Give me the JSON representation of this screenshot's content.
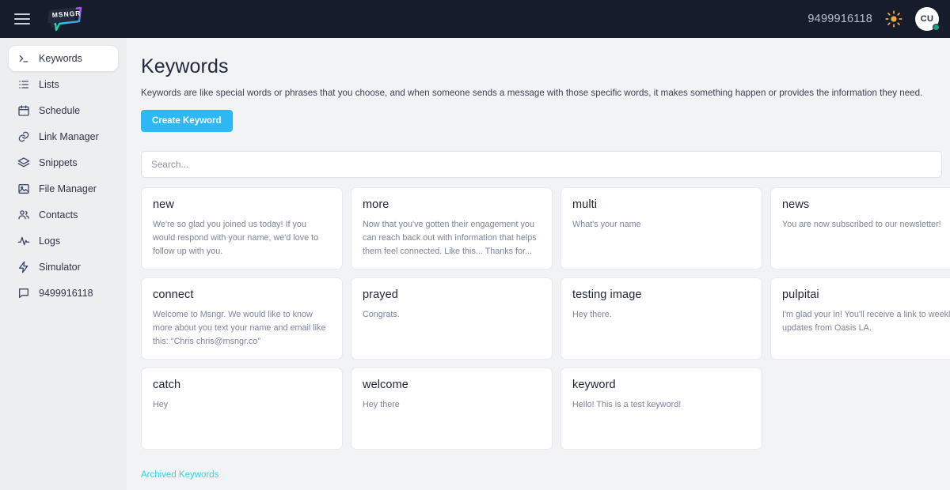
{
  "topbar": {
    "menu_icon": "hamburger-icon",
    "logo_text": "MSNGR",
    "phone": "9499916118",
    "theme_icon": "sun-icon",
    "avatar_initials": "CU",
    "status": "online"
  },
  "sidebar": {
    "items": [
      {
        "label": "Keywords",
        "icon": "terminal-icon",
        "active": true
      },
      {
        "label": "Lists",
        "icon": "list-icon",
        "active": false
      },
      {
        "label": "Schedule",
        "icon": "calendar-icon",
        "active": false
      },
      {
        "label": "Link Manager",
        "icon": "link-icon",
        "active": false
      },
      {
        "label": "Snippets",
        "icon": "layers-icon",
        "active": false
      },
      {
        "label": "File Manager",
        "icon": "image-icon",
        "active": false
      },
      {
        "label": "Contacts",
        "icon": "users-icon",
        "active": false
      },
      {
        "label": "Logs",
        "icon": "activity-icon",
        "active": false
      },
      {
        "label": "Simulator",
        "icon": "bolt-icon",
        "active": false
      },
      {
        "label": "9499916118",
        "icon": "chat-icon",
        "active": false
      }
    ]
  },
  "main": {
    "title": "Keywords",
    "description": "Keywords are like special words or phrases that you choose, and when someone sends a message with those specific words, it makes something happen or provides the information they need.",
    "create_button": "Create Keyword",
    "search_placeholder": "Search...",
    "search_value": "",
    "archived_link": "Archived Keywords",
    "keywords": [
      {
        "name": "new",
        "message": "We're so glad you joined us today! If you would respond with your name, we'd love to follow up with you."
      },
      {
        "name": "more",
        "message": "Now that you've gotten their engagement you can reach back out with information that helps them feel connected. Like this... Thanks for..."
      },
      {
        "name": "multi",
        "message": "What's your name"
      },
      {
        "name": "news",
        "message": "You are now subscribed to our newsletter!"
      },
      {
        "name": "connect",
        "message": "Welcome to Msngr. We would like to know more about you text your name and email like this: \"Chris chris@msngr.co\""
      },
      {
        "name": "prayed",
        "message": "Congrats."
      },
      {
        "name": "testing image",
        "message": "Hey there."
      },
      {
        "name": "pulpitai",
        "message": "I'm glad your in! You'll receive a link to weekly updates from Oasis LA."
      },
      {
        "name": "catch",
        "message": "Hey"
      },
      {
        "name": "welcome",
        "message": "Hey there"
      },
      {
        "name": "keyword",
        "message": "Hello! This is a test keyword!"
      }
    ]
  },
  "colors": {
    "topbar_bg": "#161c2b",
    "sidebar_bg": "#eceef0",
    "content_bg": "#f2f3f5",
    "accent_button": "#2bb8f5",
    "archived_link": "#33d6e0",
    "status_dot": "#16a085",
    "sun_icon": "#f2a93b"
  }
}
